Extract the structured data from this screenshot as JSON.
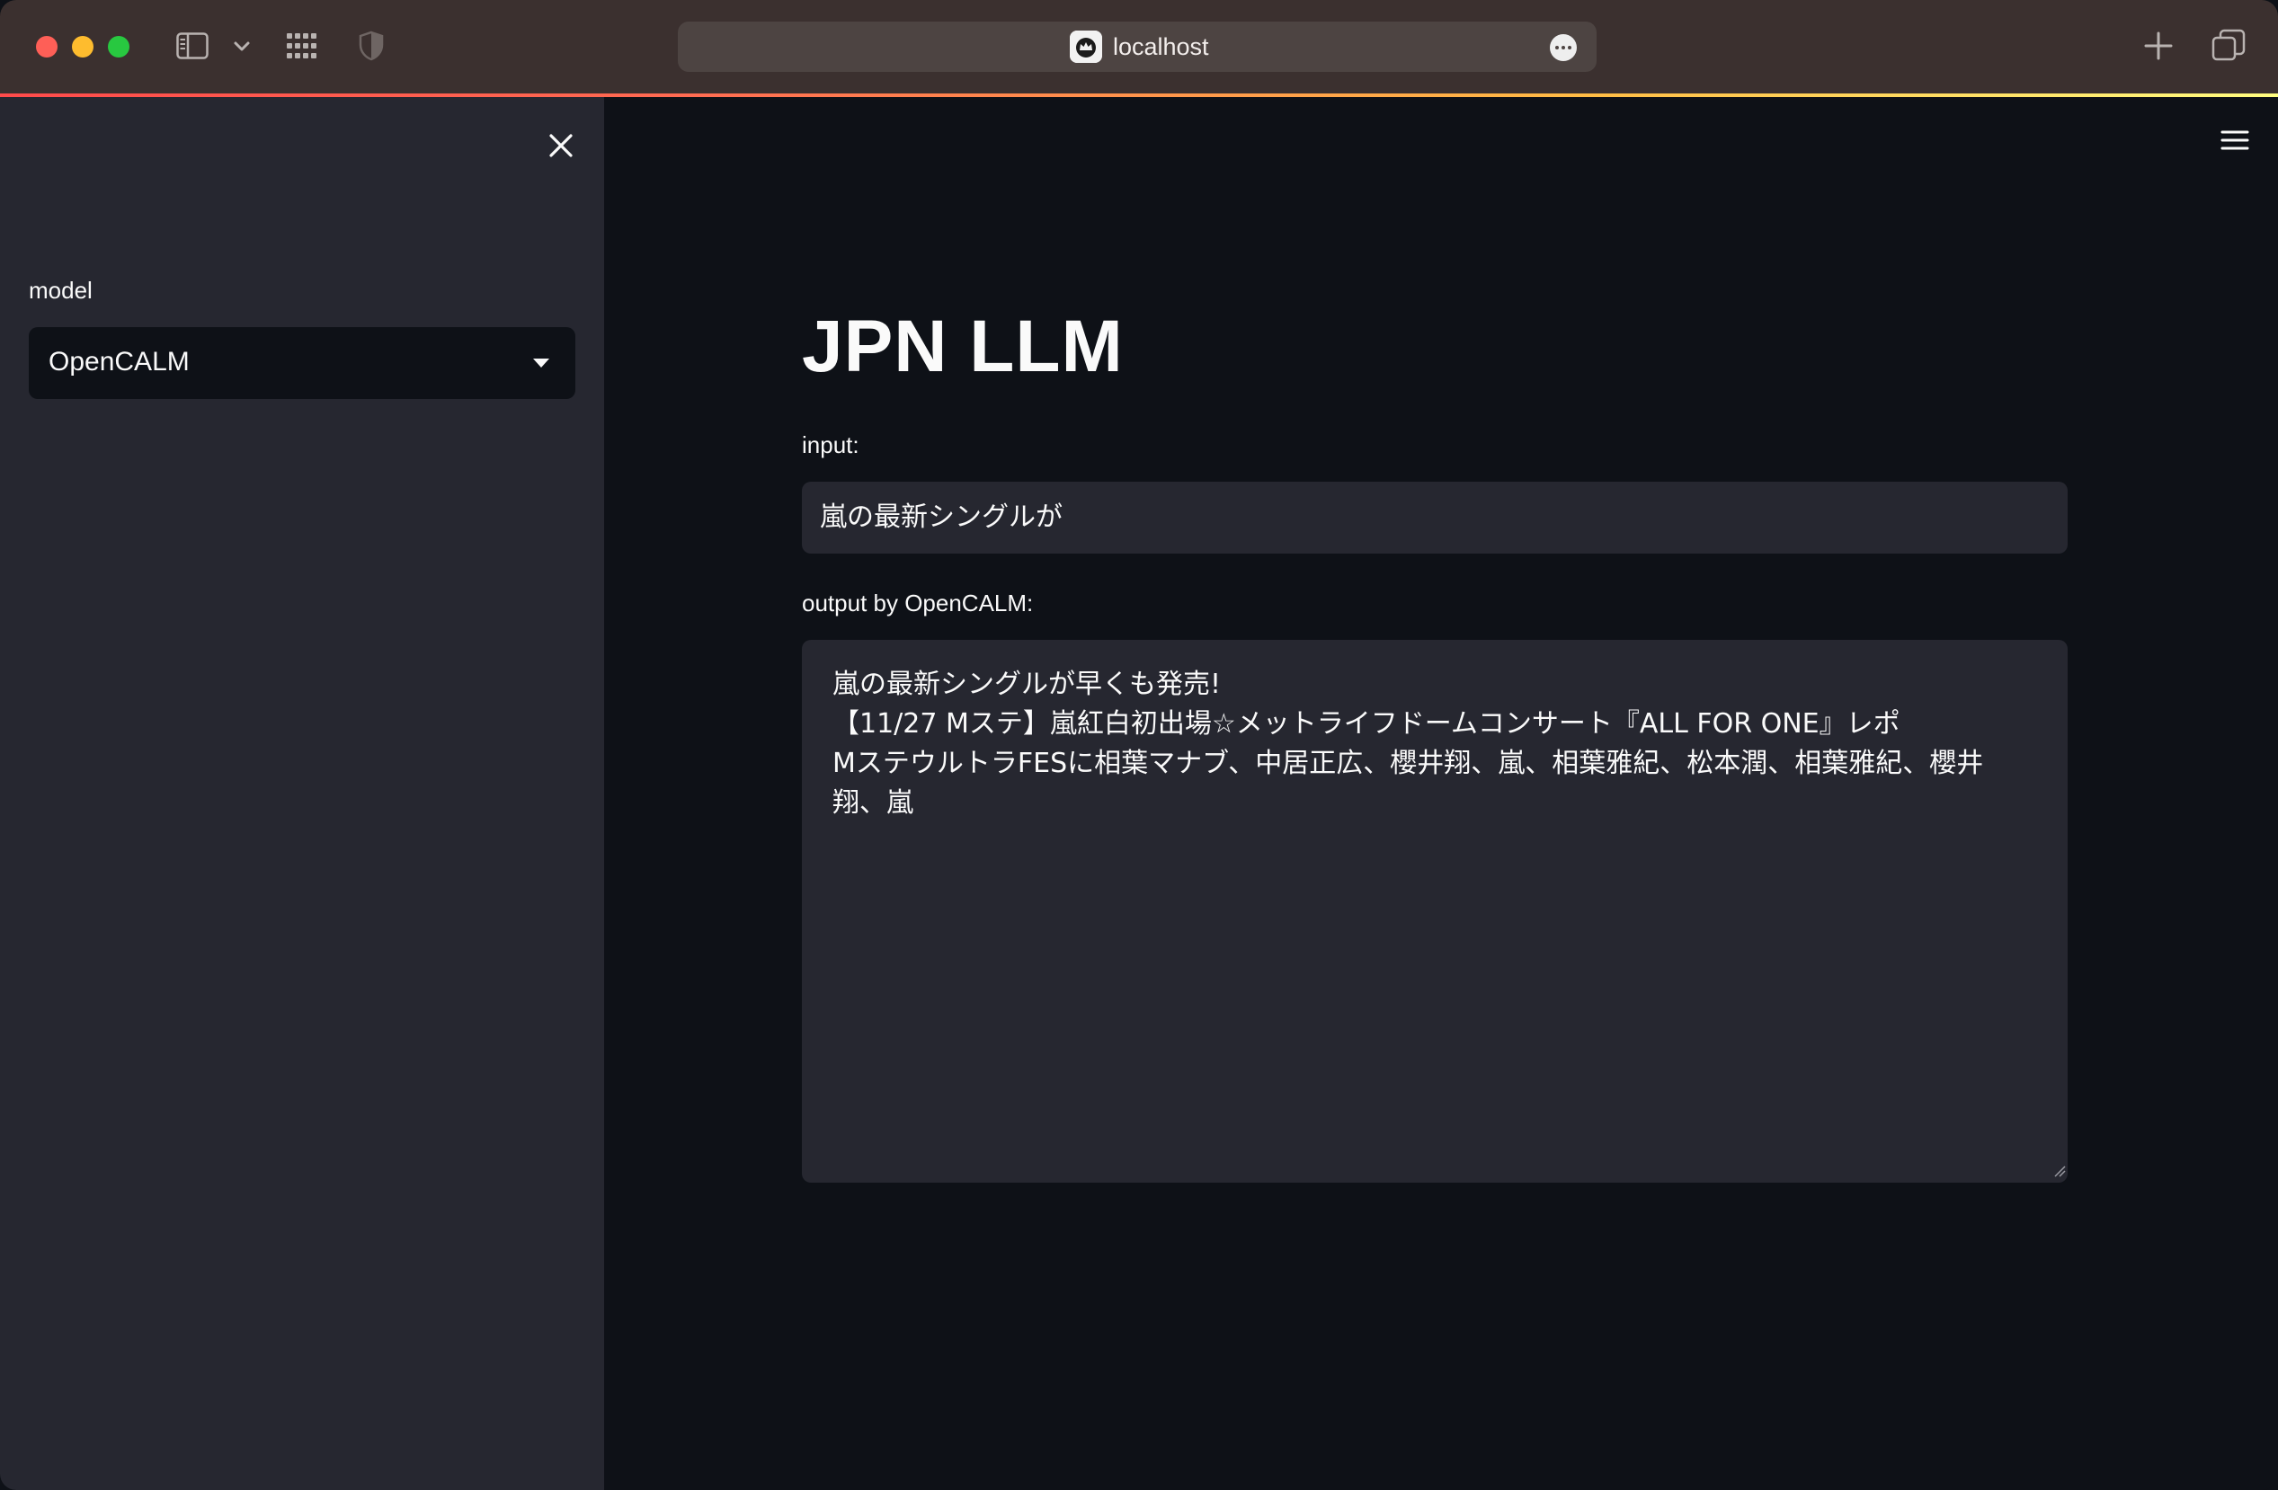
{
  "browser": {
    "address": "localhost",
    "icons": {
      "sidebar_toggle": "sidebar-icon",
      "tab_dropdown": "chevron-down-icon",
      "tab_grid": "grid-icon",
      "privacy": "shield-icon",
      "favicon": "streamlit-crown-icon",
      "page_menu": "ellipsis-icon",
      "new_tab": "plus-icon",
      "tab_overview": "tabs-overview-icon"
    },
    "traffic_lights": {
      "close": "#fe5f57",
      "minimize": "#febc2e",
      "maximize": "#28c840"
    }
  },
  "sidebar": {
    "close_icon": "close-icon",
    "model_label": "model",
    "model_selected": "OpenCALM"
  },
  "main": {
    "menu_icon": "hamburger-icon",
    "title": "JPN LLM",
    "input_label": "input:",
    "input_value": "嵐の最新シングルが",
    "output_label": "output by OpenCALM:",
    "output_text": "嵐の最新シングルが早くも発売!\n【11/27 Mステ】嵐紅白初出場☆メットライフドームコンサート『ALL FOR ONE』レポ\nMステウルトラFESに相葉マナブ、中居正広、櫻井翔、嵐、相葉雅紀、松本潤、相葉雅紀、櫻井翔、嵐"
  },
  "colors": {
    "background": "#0e1117",
    "sidebar": "#262730",
    "widget": "#262730",
    "text": "#fafafa",
    "accent": "#ff4b4b"
  }
}
